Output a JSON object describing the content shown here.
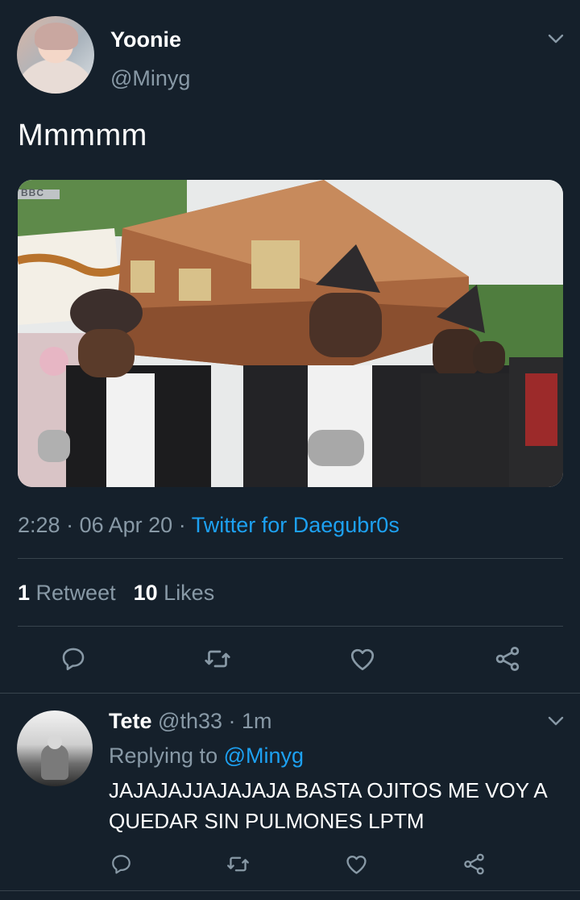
{
  "tweet": {
    "display_name": "Yoonie",
    "handle": "@Minyg",
    "text": "Mmmmm",
    "time": "2:28",
    "date": "06 Apr 20",
    "separator": "·",
    "source_app": "Twitter for Daegubr0s",
    "retweet_count": "1",
    "retweet_label": "Retweet",
    "like_count": "10",
    "like_label": "Likes",
    "media_watermark": "BBC"
  },
  "actions": {
    "icons": [
      "reply-icon",
      "retweet-icon",
      "like-icon",
      "share-icon"
    ]
  },
  "reply": {
    "display_name": "Tete",
    "handle": "@th33",
    "separator": "·",
    "time": "1m",
    "replying_to_label": "Replying to",
    "replying_to_handle": "@Minyg",
    "text": "JAJAJAJJAJAJAJA BASTA OJITOS ME VOY A QUEDAR SIN PULMONES LPTM"
  },
  "colors": {
    "background": "#15202b",
    "secondary_text": "#8899a6",
    "accent": "#1da1f2",
    "divider": "#38444d"
  }
}
